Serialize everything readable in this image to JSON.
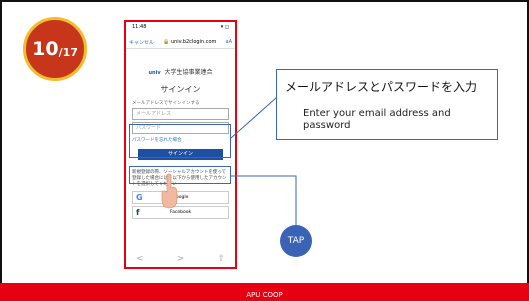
{
  "page": {
    "current": "10",
    "total": "/17"
  },
  "phone": {
    "status_time": "11:48",
    "status_icons": "▾ ◻",
    "cancel": "キャンセル",
    "url": "🔒 univ.b2clogin.com",
    "reader": "aA",
    "logo_mark": "univ",
    "org_name": "大学生協事業連合",
    "signin_title": "サインイン",
    "email_note": "メールアドレスでサインインする",
    "email_placeholder": "メールアドレス",
    "password_placeholder": "パスワード",
    "forgot": "パスワードを忘れた場合",
    "signin_button": "サインイン",
    "social_note": "新規登録の際、ソーシャルアカウントを使って登録した場合には、以下から使用したアカウントを選択してください",
    "google": "Google",
    "facebook": "Facebook",
    "back": "<",
    "forward": ">",
    "share": "⇧"
  },
  "callout": {
    "jp": "メールアドレスとパスワードを入力",
    "en": "Enter your email address and password"
  },
  "tap": "TAP",
  "footer": "APU COOP"
}
